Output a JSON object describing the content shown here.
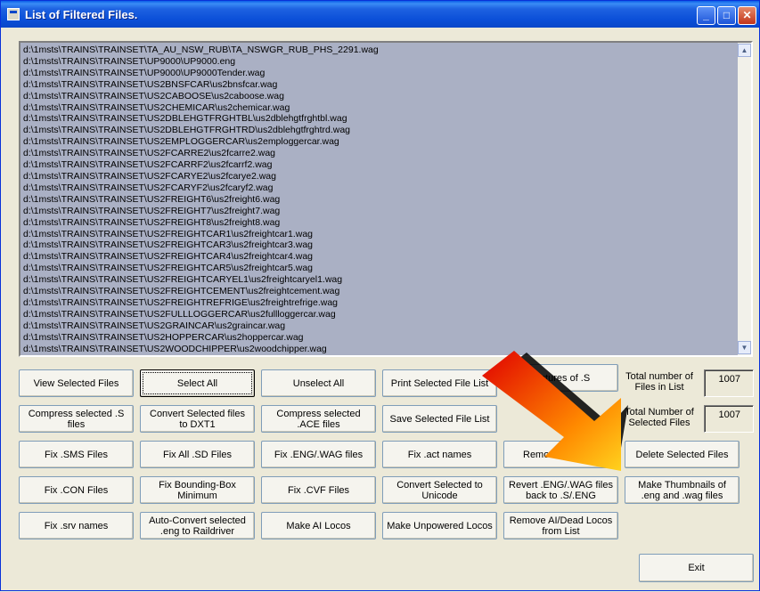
{
  "window": {
    "title": "List of Filtered Files.",
    "controls": {
      "minimize": "_",
      "maximize": "□",
      "close": "✕"
    }
  },
  "file_list": {
    "items": [
      "d:\\1msts\\TRAINS\\TRAINSET\\TA_AU_NSW_RUB\\TA_NSWGR_RUB_PHS_2291.wag",
      "d:\\1msts\\TRAINS\\TRAINSET\\UP9000\\UP9000.eng",
      "d:\\1msts\\TRAINS\\TRAINSET\\UP9000\\UP9000Tender.wag",
      "d:\\1msts\\TRAINS\\TRAINSET\\US2BNSFCAR\\us2bnsfcar.wag",
      "d:\\1msts\\TRAINS\\TRAINSET\\US2CABOOSE\\us2caboose.wag",
      "d:\\1msts\\TRAINS\\TRAINSET\\US2CHEMICAR\\us2chemicar.wag",
      "d:\\1msts\\TRAINS\\TRAINSET\\US2DBLEHGTFRGHTBL\\us2dblehgtfrghtbl.wag",
      "d:\\1msts\\TRAINS\\TRAINSET\\US2DBLEHGTFRGHTRD\\us2dblehgtfrghtrd.wag",
      "d:\\1msts\\TRAINS\\TRAINSET\\US2EMPLOGGERCAR\\us2emploggercar.wag",
      "d:\\1msts\\TRAINS\\TRAINSET\\US2FCARRE2\\us2fcarre2.wag",
      "d:\\1msts\\TRAINS\\TRAINSET\\US2FCARRF2\\us2fcarrf2.wag",
      "d:\\1msts\\TRAINS\\TRAINSET\\US2FCARYE2\\us2fcarye2.wag",
      "d:\\1msts\\TRAINS\\TRAINSET\\US2FCARYF2\\us2fcaryf2.wag",
      "d:\\1msts\\TRAINS\\TRAINSET\\US2FREIGHT6\\us2freight6.wag",
      "d:\\1msts\\TRAINS\\TRAINSET\\US2FREIGHT7\\us2freight7.wag",
      "d:\\1msts\\TRAINS\\TRAINSET\\US2FREIGHT8\\us2freight8.wag",
      "d:\\1msts\\TRAINS\\TRAINSET\\US2FREIGHTCAR1\\us2freightcar1.wag",
      "d:\\1msts\\TRAINS\\TRAINSET\\US2FREIGHTCAR3\\us2freightcar3.wag",
      "d:\\1msts\\TRAINS\\TRAINSET\\US2FREIGHTCAR4\\us2freightcar4.wag",
      "d:\\1msts\\TRAINS\\TRAINSET\\US2FREIGHTCAR5\\us2freightcar5.wag",
      "d:\\1msts\\TRAINS\\TRAINSET\\US2FREIGHTCARYEL1\\us2freightcaryel1.wag",
      "d:\\1msts\\TRAINS\\TRAINSET\\US2FREIGHTCEMENT\\us2freightcement.wag",
      "d:\\1msts\\TRAINS\\TRAINSET\\US2FREIGHTREFRIGE\\us2freightrefrige.wag",
      "d:\\1msts\\TRAINS\\TRAINSET\\US2FULLLOGGERCAR\\us2fullloggercar.wag",
      "d:\\1msts\\TRAINS\\TRAINSET\\US2GRAINCAR\\us2graincar.wag",
      "d:\\1msts\\TRAINS\\TRAINSET\\US2HOPPERCAR\\us2hoppercar.wag",
      "d:\\1msts\\TRAINS\\TRAINSET\\US2WOODCHIPPER\\us2woodchipper.wag"
    ],
    "scroll_up": "▲",
    "scroll_down": "▼"
  },
  "buttons": {
    "view_selected": "View Selected Files",
    "select_all": "Select All",
    "unselect_all": "Unselect All",
    "print_selected": "Print Selected File List",
    "pictures": "Pictures of .S",
    "compress_s": "Compress selected .S files",
    "convert_dxt1": "Convert Selected files to DXT1",
    "compress_ace": "Compress selected .ACE files",
    "save_selected": "Save Selected File List",
    "fix_sms": "Fix .SMS Files",
    "fix_all_sd": "Fix All .SD Files",
    "fix_eng_wag": "Fix .ENG/.WAG files",
    "fix_act": "Fix .act names",
    "remove_selected": "Remove selected",
    "delete_selected": "Delete Selected Files",
    "fix_con": "Fix .CON Files",
    "fix_bbox": "Fix Bounding-Box Minimum",
    "fix_cvf": "Fix .CVF Files",
    "convert_unicode": "Convert Selected to Unicode",
    "revert": "Revert .ENG/.WAG files back to .S/.ENG",
    "thumbnails": "Make Thumbnails of .eng and .wag files",
    "fix_srv": "Fix .srv names",
    "auto_convert": "Auto-Convert selected .eng to Raildriver",
    "make_ai": "Make AI Locos",
    "make_unpowered": "Make Unpowered Locos",
    "remove_ai_dead": "Remove AI/Dead Locos from List",
    "exit": "Exit"
  },
  "stats": {
    "total_label": "Total number of Files in List",
    "total_value": "1007",
    "selected_label": "Total Number of Selected Files",
    "selected_value": "1007"
  },
  "overlay": {
    "arrow_colors": [
      "#e00000",
      "#ff8a00",
      "#ffd21e"
    ]
  }
}
